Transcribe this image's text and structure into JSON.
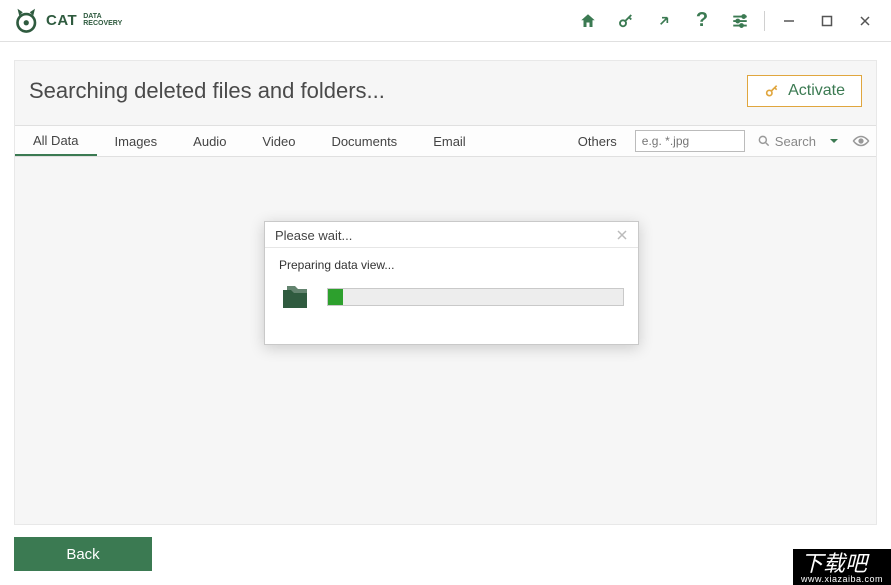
{
  "app": {
    "logo_brand": "CAT",
    "logo_line1": "DATA",
    "logo_line2": "RECOVERY"
  },
  "header": {
    "title": "Searching deleted files and folders...",
    "activate_label": "Activate"
  },
  "tabs": {
    "items": [
      {
        "label": "All Data"
      },
      {
        "label": "Images"
      },
      {
        "label": "Audio"
      },
      {
        "label": "Video"
      },
      {
        "label": "Documents"
      },
      {
        "label": "Email"
      },
      {
        "label": "Others"
      }
    ]
  },
  "search": {
    "placeholder": "e.g. *.jpg",
    "button_label": "Search"
  },
  "dialog": {
    "title": "Please wait...",
    "message": "Preparing data view...",
    "progress_percent": 5
  },
  "footer": {
    "back_label": "Back"
  },
  "watermark": {
    "text": "下载吧",
    "url": "www.xiazaiba.com"
  },
  "colors": {
    "brand": "#3b7a52",
    "accent": "#e0a63e",
    "progress": "#2da02d"
  }
}
